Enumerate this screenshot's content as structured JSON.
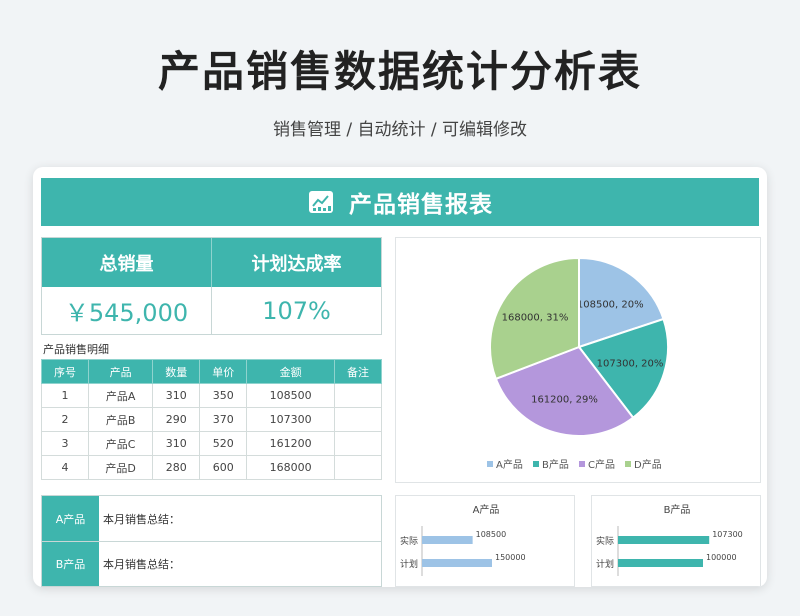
{
  "page": {
    "title": "产品销售数据统计分析表",
    "subtitle": "销售管理 / 自动统计 / 可编辑修改"
  },
  "banner": {
    "title": "产品销售报表",
    "icon": "chart-report-icon"
  },
  "kpi": {
    "total_label": "总销量",
    "rate_label": "计划达成率",
    "total_value": "￥545,000",
    "rate_value": "107%"
  },
  "detail": {
    "label": "产品销售明细",
    "headers": [
      "序号",
      "产品",
      "数量",
      "单价",
      "金额",
      "备注"
    ],
    "rows": [
      [
        "1",
        "产品A",
        "310",
        "350",
        "108500",
        ""
      ],
      [
        "2",
        "产品B",
        "290",
        "370",
        "107300",
        ""
      ],
      [
        "3",
        "产品C",
        "310",
        "520",
        "161200",
        ""
      ],
      [
        "4",
        "产品D",
        "280",
        "600",
        "168000",
        ""
      ]
    ]
  },
  "summary": {
    "rows": [
      {
        "key": "A产品",
        "value": "本月销售总结："
      },
      {
        "key": "B产品",
        "value": "本月销售总结："
      }
    ]
  },
  "colors": {
    "accent": "#3eb5ad",
    "a": "#9dc3e6",
    "b": "#3eb5ad",
    "c": "#b497dc",
    "d": "#a9d18e"
  },
  "chart_data": [
    {
      "type": "pie",
      "categories": [
        "A产品",
        "B产品",
        "C产品",
        "D产品"
      ],
      "values": [
        108500,
        107300,
        161200,
        168000
      ],
      "data_labels": [
        "108500, 20%",
        "107300, 20%",
        "161200, 29%",
        "168000, 31%"
      ],
      "legend": "bottom",
      "colors": [
        "#9dc3e6",
        "#3eb5ad",
        "#b497dc",
        "#a9d18e"
      ]
    },
    {
      "type": "bar",
      "orientation": "horizontal",
      "title": "A产品",
      "categories": [
        "实际",
        "计划"
      ],
      "values": [
        108500,
        150000
      ],
      "data_labels": [
        "108500",
        "150000"
      ],
      "color": "#9dc3e6",
      "xlim": [
        0,
        240000
      ]
    },
    {
      "type": "bar",
      "orientation": "horizontal",
      "title": "B产品",
      "categories": [
        "实际",
        "计划"
      ],
      "values": [
        107300,
        100000
      ],
      "data_labels": [
        "107300",
        "100000"
      ],
      "color": "#3eb5ad",
      "xlim": [
        0,
        120000
      ]
    }
  ]
}
